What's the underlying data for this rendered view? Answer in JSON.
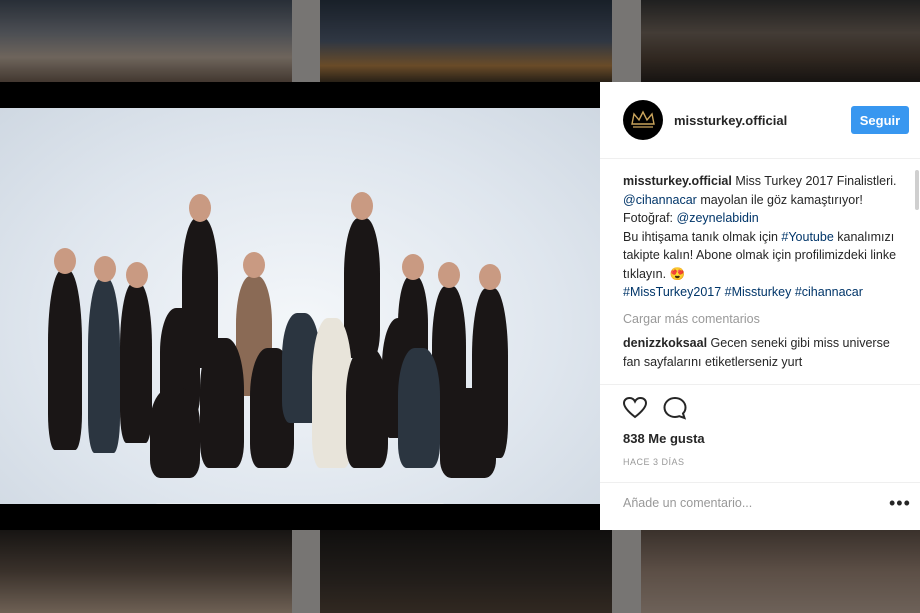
{
  "post": {
    "username": "missturkey.official",
    "follow_label": "Seguir",
    "caption_user": "missturkey.official",
    "caption_lines": {
      "p1": " Miss Turkey 2017 Finalistleri. ",
      "mention1": "@cihannacar",
      "p2": " mayolan ile göz kamaştırıyor!",
      "p3": "Fotoğraf: ",
      "mention2": "@zeynelabidin",
      "p4": "Bu ihtişama tanık olmak için ",
      "tag_youtube": "#Youtube",
      "p5": " kanalımızı takipte kalın! Abone olmak için profilimizdeki linke tıklayın. ",
      "emoji": "😍",
      "tags": "#MissTurkey2017 #Missturkey #cihannacar"
    },
    "load_more": "Cargar más comentarios",
    "comment_user": "denizzkoksaal",
    "comment_text": " Gecen seneki gibi miss universe fan sayfalarını etiketlerseniz yurt",
    "likes": "838 Me gusta",
    "time": "HACE 3 DÍAS",
    "add_comment_placeholder": "Añade un comentario...",
    "more_icon": "•••"
  },
  "colors": {
    "accent": "#3897f0",
    "link": "#003569"
  },
  "icons": {
    "avatar_logo": "crown-logo-icon",
    "like": "heart-icon",
    "comment": "comment-bubble-icon",
    "options": "more-options-icon"
  }
}
